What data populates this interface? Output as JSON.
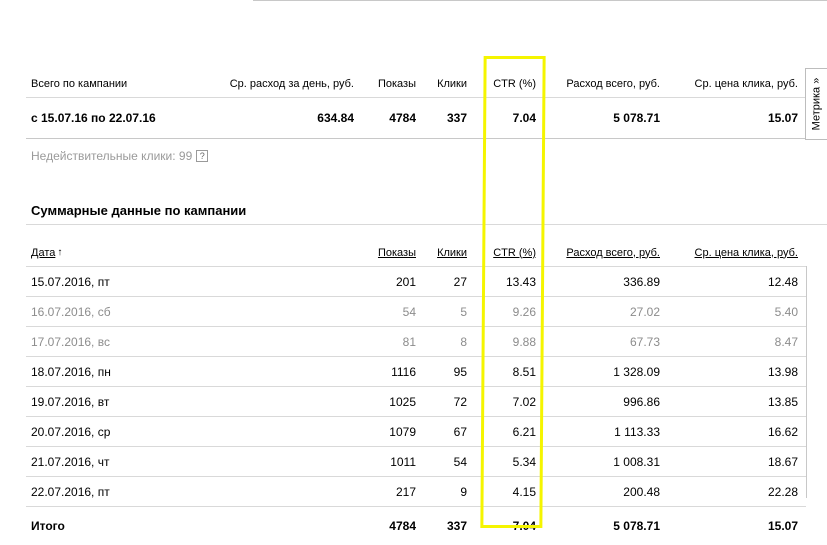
{
  "summary": {
    "headers": {
      "campaign": "Всего по кампании",
      "avg_day_spend": "Ср. расход за день, руб.",
      "impressions": "Показы",
      "clicks": "Клики",
      "ctr": "CTR (%)",
      "total_spend": "Расход всего, руб.",
      "avg_cpc": "Ср. цена клика, руб."
    },
    "row": {
      "period": "с 15.07.16 по 22.07.16",
      "avg_day_spend": "634.84",
      "impressions": "4784",
      "clicks": "337",
      "ctr": "7.04",
      "total_spend": "5 078.71",
      "avg_cpc": "15.07"
    },
    "metrika_label": "Метрика »"
  },
  "invalid_clicks": {
    "label": "Недействительные клики: 99",
    "help_icon": "?"
  },
  "daily": {
    "title": "Суммарные данные по кампании",
    "headers": {
      "date": "Дата",
      "impressions": "Показы",
      "clicks": "Клики",
      "ctr": "CTR (%)",
      "total_spend": "Расход всего, руб.",
      "avg_cpc": "Ср. цена клика, руб."
    },
    "sort_indicator": "↑",
    "rows": [
      {
        "date": "15.07.2016, пт",
        "impressions": "201",
        "clicks": "27",
        "ctr": "13.43",
        "spend": "336.89",
        "cpc": "12.48",
        "weekend": false
      },
      {
        "date": "16.07.2016, сб",
        "impressions": "54",
        "clicks": "5",
        "ctr": "9.26",
        "spend": "27.02",
        "cpc": "5.40",
        "weekend": true
      },
      {
        "date": "17.07.2016, вс",
        "impressions": "81",
        "clicks": "8",
        "ctr": "9.88",
        "spend": "67.73",
        "cpc": "8.47",
        "weekend": true
      },
      {
        "date": "18.07.2016, пн",
        "impressions": "1116",
        "clicks": "95",
        "ctr": "8.51",
        "spend": "1 328.09",
        "cpc": "13.98",
        "weekend": false
      },
      {
        "date": "19.07.2016, вт",
        "impressions": "1025",
        "clicks": "72",
        "ctr": "7.02",
        "spend": "996.86",
        "cpc": "13.85",
        "weekend": false
      },
      {
        "date": "20.07.2016, ср",
        "impressions": "1079",
        "clicks": "67",
        "ctr": "6.21",
        "spend": "1 113.33",
        "cpc": "16.62",
        "weekend": false
      },
      {
        "date": "21.07.2016, чт",
        "impressions": "1011",
        "clicks": "54",
        "ctr": "5.34",
        "spend": "1 008.31",
        "cpc": "18.67",
        "weekend": false
      },
      {
        "date": "22.07.2016, пт",
        "impressions": "217",
        "clicks": "9",
        "ctr": "4.15",
        "spend": "200.48",
        "cpc": "22.28",
        "weekend": false
      }
    ],
    "total": {
      "label": "Итого",
      "impressions": "4784",
      "clicks": "337",
      "ctr": "7.04",
      "spend": "5 078.71",
      "cpc": "15.07"
    }
  },
  "colors": {
    "highlight": "#f5f500",
    "weekend_text": "#8c8c8c",
    "divider": "#d9d9d9"
  }
}
